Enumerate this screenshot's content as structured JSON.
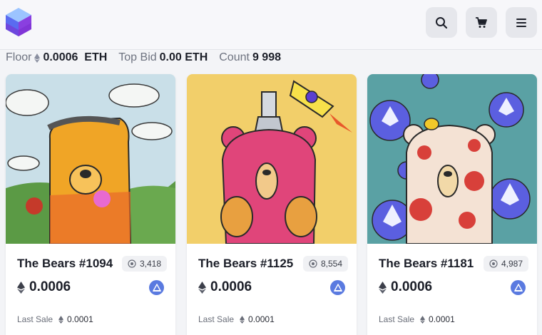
{
  "header": {
    "logo": "cube-logo-icon",
    "buttons": [
      "search-icon",
      "cart-icon",
      "menu-icon"
    ]
  },
  "stats": {
    "floor_label": "Floor",
    "floor_value": "0.0006  ETH",
    "top_bid_label": "Top Bid",
    "top_bid_value": "0.00 ETH",
    "count_label": "Count",
    "count_value": "9 998"
  },
  "cards": [
    {
      "title": "The Bears #1094",
      "views": "3,418",
      "price": "0.0006",
      "last_sale_label": "Last Sale",
      "last_sale_value": "0.0001"
    },
    {
      "title": "The Bears #1125",
      "views": "8,554",
      "price": "0.0006",
      "last_sale_label": "Last Sale",
      "last_sale_value": "0.0001"
    },
    {
      "title": "The Bears #1181",
      "views": "4,987",
      "price": "0.0006",
      "last_sale_label": "Last Sale",
      "last_sale_value": "0.0001"
    }
  ],
  "colors": {
    "accent": "#5a7ae0",
    "logo_purple": "#7b3fe4",
    "logo_blue": "#6aa7ff"
  }
}
